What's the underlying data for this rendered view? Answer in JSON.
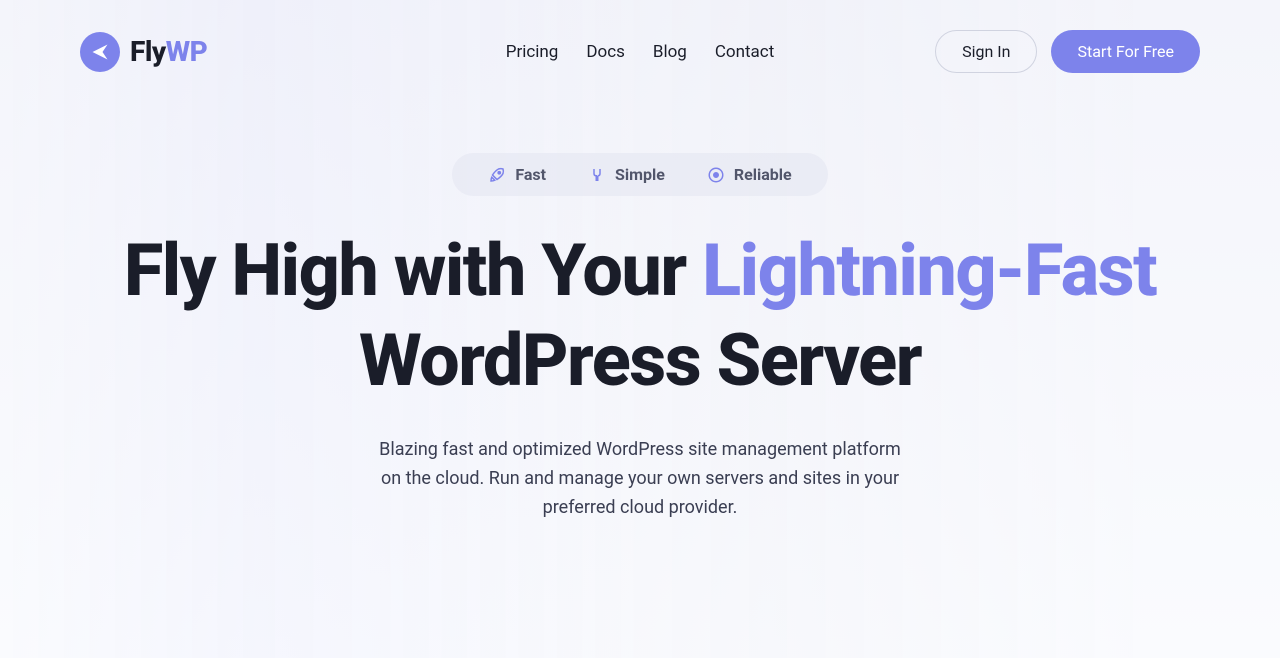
{
  "brand": {
    "part1": "Fly",
    "part2": "WP"
  },
  "nav": {
    "items": [
      {
        "label": "Pricing"
      },
      {
        "label": "Docs"
      },
      {
        "label": "Blog"
      },
      {
        "label": "Contact"
      }
    ]
  },
  "actions": {
    "signin": "Sign In",
    "cta": "Start For Free"
  },
  "hero": {
    "pills": [
      {
        "label": "Fast"
      },
      {
        "label": "Simple"
      },
      {
        "label": "Reliable"
      }
    ],
    "headline_pre": "Fly High with Your ",
    "headline_highlight": "Lightning-Fast",
    "headline_post": " WordPress Server",
    "subhead": "Blazing fast and optimized WordPress site management platform on the cloud. Run and manage your own servers and sites in your preferred cloud provider."
  }
}
